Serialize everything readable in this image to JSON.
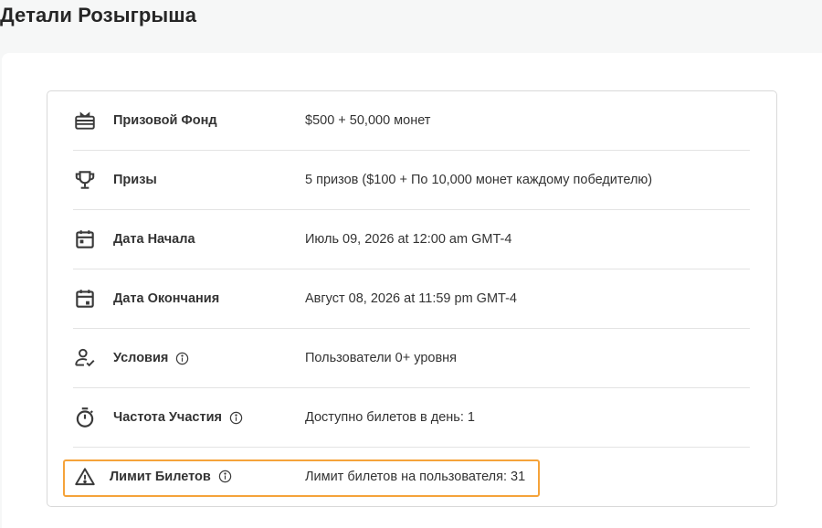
{
  "page": {
    "title": "Детали Розыгрыша"
  },
  "details": {
    "rows": [
      {
        "icon": "gift-card-icon",
        "label": "Призовой Фонд",
        "value": "$500 + 50,000 монет",
        "info": false
      },
      {
        "icon": "trophy-icon",
        "label": "Призы",
        "value": "5 призов ($100 + По 10,000 монет каждому победителю)",
        "info": false
      },
      {
        "icon": "calendar-start-icon",
        "label": "Дата Начала",
        "value": "Июль 09, 2026 at 12:00 am GMT-4",
        "info": false
      },
      {
        "icon": "calendar-end-icon",
        "label": "Дата Окончания",
        "value": "Август 08, 2026 at 11:59 pm GMT-4",
        "info": false
      },
      {
        "icon": "user-check-icon",
        "label": "Условия",
        "value": "Пользователи 0+ уровня",
        "info": true
      },
      {
        "icon": "stopwatch-icon",
        "label": "Частота Участия",
        "value": "Доступно билетов в день: 1",
        "info": true
      },
      {
        "icon": "warning-triangle-icon",
        "label": "Лимит Билетов",
        "value": "Лимит билетов на пользователя: 31",
        "info": true
      }
    ]
  },
  "colors": {
    "highlight_border": "#f5a33a",
    "icon": "#3a3a3a"
  }
}
